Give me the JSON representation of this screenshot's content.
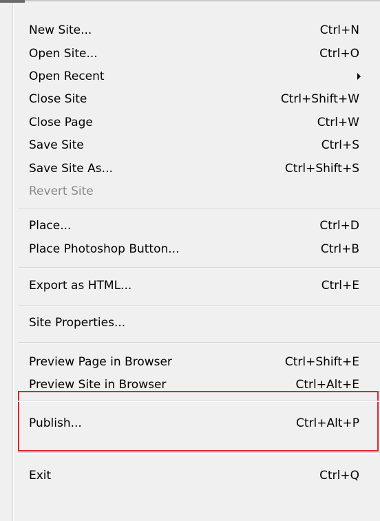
{
  "menu": {
    "items": [
      {
        "label": "New Site...",
        "shortcut": "Ctrl+N",
        "enabled": true
      },
      {
        "label": "Open Site...",
        "shortcut": "Ctrl+O",
        "enabled": true
      },
      {
        "label": "Open Recent",
        "shortcut": "",
        "submenu": true,
        "enabled": true
      },
      {
        "label": "Close Site",
        "shortcut": "Ctrl+Shift+W",
        "enabled": true
      },
      {
        "label": "Close Page",
        "shortcut": "Ctrl+W",
        "enabled": true
      },
      {
        "label": "Save Site",
        "shortcut": "Ctrl+S",
        "enabled": true
      },
      {
        "label": "Save Site As...",
        "shortcut": "Ctrl+Shift+S",
        "enabled": true
      },
      {
        "label": "Revert Site",
        "shortcut": "",
        "enabled": false
      },
      {
        "label": "Place...",
        "shortcut": "Ctrl+D",
        "enabled": true
      },
      {
        "label": "Place Photoshop Button...",
        "shortcut": "Ctrl+B",
        "enabled": true
      },
      {
        "label": "Export as HTML...",
        "shortcut": "Ctrl+E",
        "enabled": true
      },
      {
        "label": "Site Properties...",
        "shortcut": "",
        "enabled": true
      },
      {
        "label": "Preview Page in Browser",
        "shortcut": "Ctrl+Shift+E",
        "enabled": true
      },
      {
        "label": "Preview Site in Browser",
        "shortcut": "Ctrl+Alt+E",
        "enabled": true
      },
      {
        "label": "Publish...",
        "shortcut": "Ctrl+Alt+P",
        "enabled": true
      },
      {
        "label": "Exit",
        "shortcut": "Ctrl+Q",
        "enabled": true
      }
    ]
  },
  "colors": {
    "highlight_border": "#e0242c",
    "disabled_text": "#8a8a8a",
    "menu_background": "#f0f0f0"
  }
}
